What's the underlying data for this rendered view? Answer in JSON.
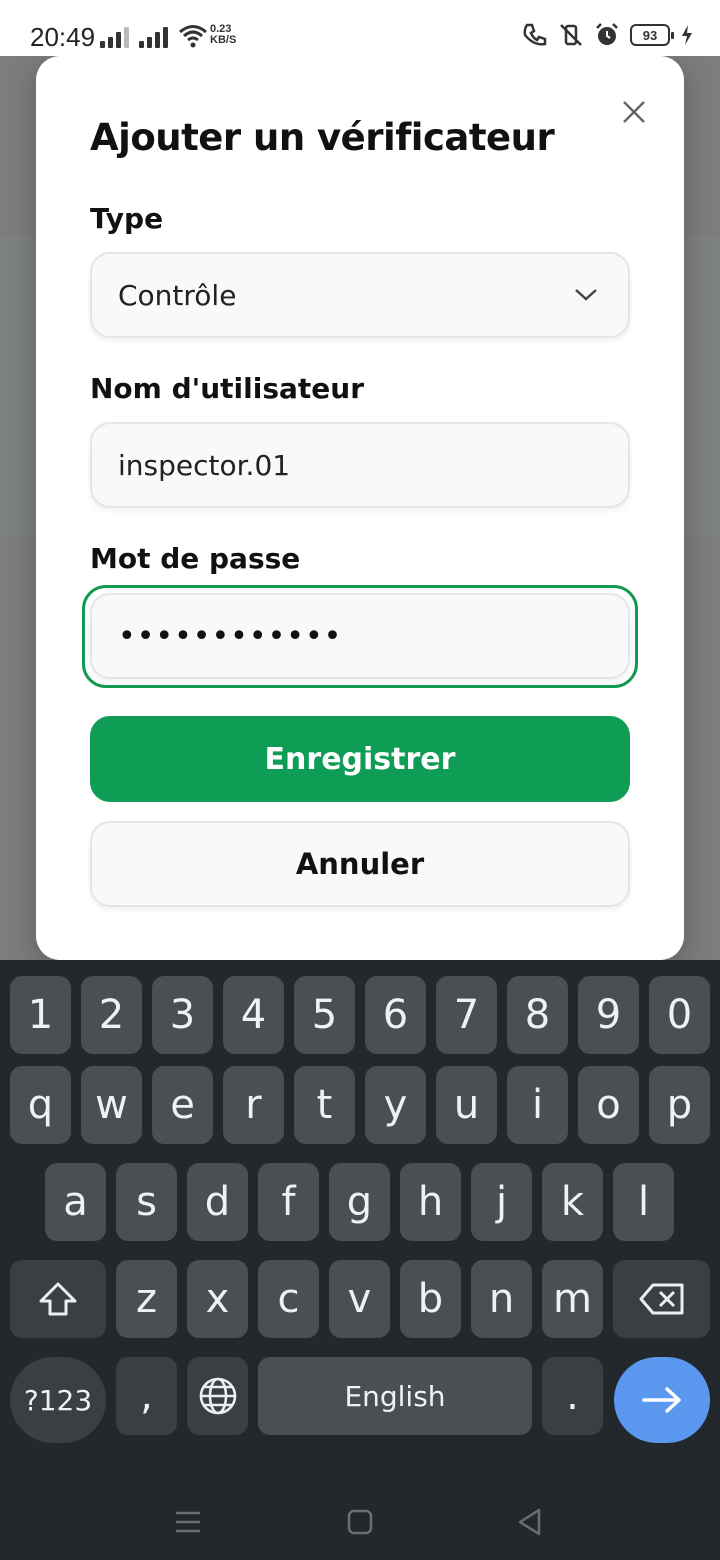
{
  "status_bar": {
    "time": "20:49",
    "net_speed_value": "0.23",
    "net_speed_unit": "KB/S",
    "battery": "93",
    "icons": [
      "signal-icon",
      "signal-icon",
      "wifi-icon",
      "call-icon",
      "vibrate-off-icon",
      "alarm-icon",
      "battery-icon",
      "charging-icon"
    ]
  },
  "dialog": {
    "title": "Ajouter un vérificateur",
    "close_icon": "close-icon",
    "type_label": "Type",
    "type_value": "Contrôle",
    "username_label": "Nom d'utilisateur",
    "username_value": "inspector.01",
    "password_label": "Mot de passe",
    "password_value": "••••••••••••",
    "save_label": "Enregistrer",
    "cancel_label": "Annuler"
  },
  "colors": {
    "primary": "#0f9d55",
    "focus_border": "#149a50",
    "keyboard_bg": "#23282c",
    "key_bg": "#4a4f54",
    "action_key": "#5b96ef"
  },
  "keyboard": {
    "row1": [
      "1",
      "2",
      "3",
      "4",
      "5",
      "6",
      "7",
      "8",
      "9",
      "0"
    ],
    "row2": [
      "q",
      "w",
      "e",
      "r",
      "t",
      "y",
      "u",
      "i",
      "o",
      "p"
    ],
    "row3": [
      "a",
      "s",
      "d",
      "f",
      "g",
      "h",
      "j",
      "k",
      "l"
    ],
    "row4": [
      "z",
      "x",
      "c",
      "v",
      "b",
      "n",
      "m"
    ],
    "symbols_label": "?123",
    "comma": ",",
    "space_label": "English",
    "period": "."
  }
}
